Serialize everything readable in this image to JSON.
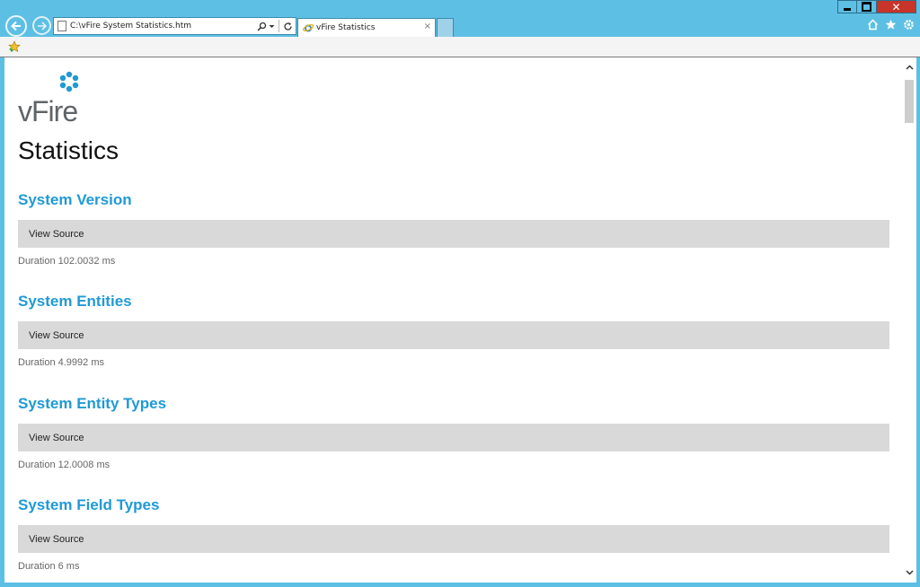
{
  "browser": {
    "address": "C:\\vFire System Statistics.htm",
    "tab_title": "vFire Statistics",
    "close_glyph": "×"
  },
  "page": {
    "logo_text": "vFire",
    "title": "Statistics",
    "sections": [
      {
        "title": "System Version",
        "view_source": "View Source",
        "duration": "Duration 102.0032 ms"
      },
      {
        "title": "System Entities",
        "view_source": "View Source",
        "duration": "Duration 4.9992 ms"
      },
      {
        "title": "System Entity Types",
        "view_source": "View Source",
        "duration": "Duration 12.0008 ms"
      },
      {
        "title": "System Field Types",
        "view_source": "View Source",
        "duration": "Duration 6 ms"
      }
    ]
  },
  "colors": {
    "chrome": "#5ebfe4",
    "section_title": "#1f9ad6",
    "view_source_bar": "#d9d9d9",
    "close_button": "#c7352a"
  },
  "icons": {
    "back": "back-arrow-icon",
    "forward": "forward-arrow-icon",
    "search": "search-icon",
    "refresh": "refresh-icon",
    "home": "home-icon",
    "favorites": "star-icon",
    "settings": "gear-icon"
  }
}
